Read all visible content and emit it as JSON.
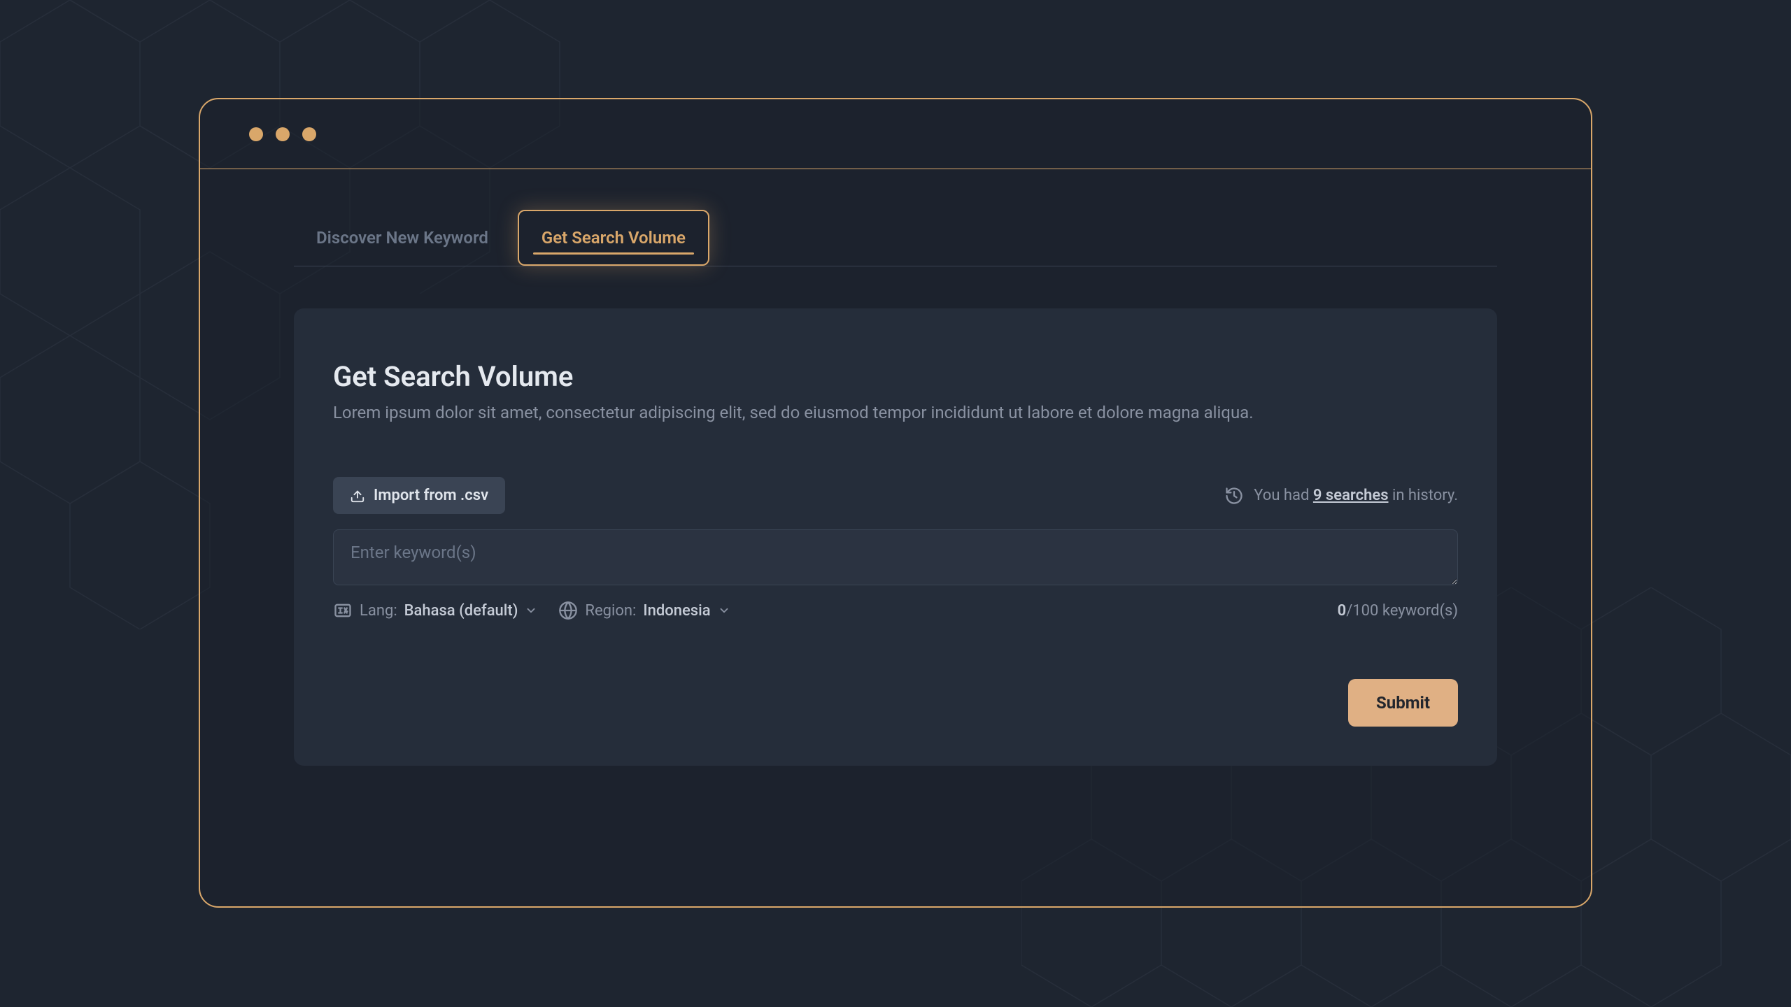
{
  "tabs": {
    "discover": "Discover New Keyword",
    "getvolume": "Get Search Volume"
  },
  "card": {
    "title": "Get Search Volume",
    "subtitle": "Lorem ipsum dolor sit amet, consectetur adipiscing elit, sed do eiusmod tempor incididunt ut labore et dolore magna aliqua."
  },
  "toolbar": {
    "import_label": "Import from .csv",
    "history_prefix": "You had ",
    "history_count": "9 searches",
    "history_suffix": " in history."
  },
  "input": {
    "placeholder": "Enter keyword(s)"
  },
  "meta": {
    "lang_label": "Lang:",
    "lang_value": "Bahasa (default)",
    "region_label": "Region:",
    "region_value": "Indonesia",
    "count_current": "0",
    "count_sep": "/100 ",
    "count_suffix": "keyword(s)"
  },
  "actions": {
    "submit": "Submit"
  },
  "colors": {
    "accent": "#d9a76a",
    "bg": "#1e2530",
    "card": "#252d3a"
  }
}
